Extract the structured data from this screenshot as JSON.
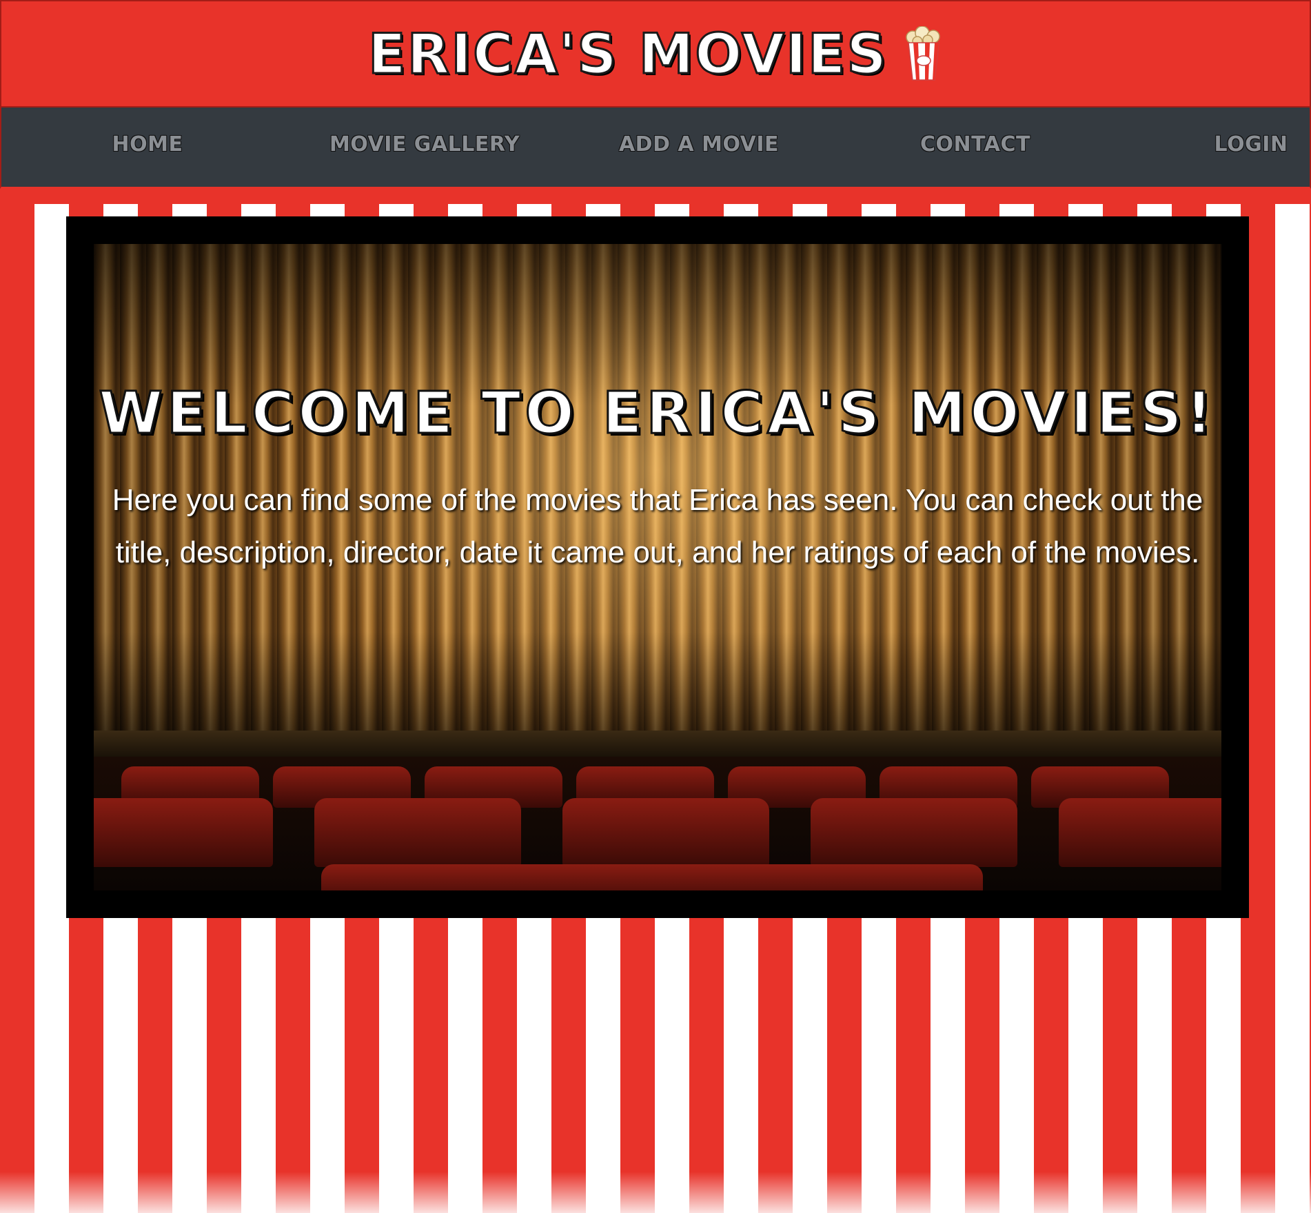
{
  "header": {
    "title": "ERICA'S MOVIES",
    "logo_icon": "popcorn-icon"
  },
  "nav": {
    "items": [
      {
        "label": "HOME"
      },
      {
        "label": "MOVIE GALLERY"
      },
      {
        "label": "ADD A MOVIE"
      },
      {
        "label": "CONTACT"
      },
      {
        "label": "LOGIN"
      }
    ]
  },
  "hero": {
    "heading": "WELCOME TO ERICA'S MOVIES!",
    "text": "Here you can find some of the movies that Erica has seen. You can check out the title, description, director, date it came out, and her ratings of each of the movies.",
    "background_image": "theater-curtain-seats"
  },
  "colors": {
    "brand_red": "#e8332a",
    "nav_bg": "#343a40",
    "nav_text": "#8b8f94",
    "stripe_white": "#ffffff"
  }
}
